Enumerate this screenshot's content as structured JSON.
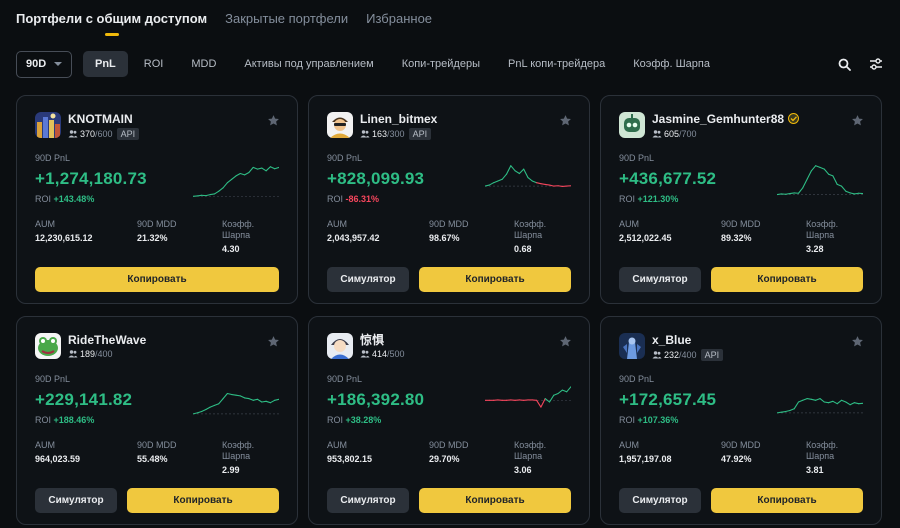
{
  "top_tabs": [
    {
      "label": "Портфели с общим доступом",
      "active": true
    },
    {
      "label": "Закрытые портфели",
      "active": false
    },
    {
      "label": "Избранное",
      "active": false
    }
  ],
  "filters": {
    "period": "90D",
    "sort_tabs": [
      {
        "label": "PnL",
        "active": true
      },
      {
        "label": "ROI",
        "active": false
      },
      {
        "label": "MDD",
        "active": false
      },
      {
        "label": "Активы под управлением",
        "active": false
      },
      {
        "label": "Копи-трейдеры",
        "active": false
      },
      {
        "label": "PnL копи-трейдера",
        "active": false
      },
      {
        "label": "Коэфф. Шарпа",
        "active": false
      }
    ],
    "icons": [
      "search-icon",
      "filter-settings-icon"
    ]
  },
  "card_labels": {
    "pnl": "90D PnL",
    "roi": "ROI",
    "aum": "AUM",
    "mdd": "90D MDD",
    "sharpe": "Коэфф. Шарпа",
    "simulator": "Симулятор",
    "copy": "Копировать",
    "api": "API"
  },
  "colors": {
    "positive": "#2ebd85",
    "negative": "#f6465d",
    "accent": "#f0b90b",
    "copy_button": "#f0c83e"
  },
  "cards": [
    {
      "name": "KNOTMAIN",
      "copiers": "370",
      "capacity": "/600",
      "api": true,
      "badge": false,
      "avatar": "city-night-avatar",
      "pnl": "+1,274,180.73",
      "roi": "+143.48%",
      "roi_sign": "pos",
      "aum": "12,230,615.12",
      "mdd": "21.32%",
      "sharpe": "4.30",
      "simulator": false,
      "spark": {
        "series": [
          0.05,
          0.06,
          0.08,
          0.07,
          0.1,
          0.12,
          0.2,
          0.3,
          0.45,
          0.55,
          0.65,
          0.72,
          0.68,
          0.75,
          0.9,
          0.85,
          0.88,
          0.8,
          0.92,
          0.86,
          0.9
        ],
        "color": "#2ebd85"
      }
    },
    {
      "name": "Linen_bitmex",
      "copiers": "163",
      "capacity": "/300",
      "api": true,
      "badge": false,
      "avatar": "cartoon-person-avatar",
      "pnl": "+828,099.93",
      "roi": "-86.31%",
      "roi_sign": "neg",
      "aum": "2,043,957.42",
      "mdd": "98.67%",
      "sharpe": "0.68",
      "simulator": true,
      "spark": {
        "series": [
          0.35,
          0.38,
          0.45,
          0.5,
          0.55,
          0.7,
          0.95,
          0.8,
          0.72,
          0.85,
          0.6,
          0.5,
          0.45,
          0.42,
          0.4,
          0.38,
          0.35,
          0.36,
          0.34,
          0.35,
          0.36
        ],
        "color": "#2ebd85",
        "tail_color": "#f6465d",
        "tail_from": 12
      }
    },
    {
      "name": "Jasmine_Gemhunter88",
      "copiers": "605",
      "capacity": "/700",
      "api": false,
      "badge": true,
      "avatar": "robot-avatar",
      "pnl": "+436,677.52",
      "roi": "+121.30%",
      "roi_sign": "pos",
      "aum": "2,512,022.45",
      "mdd": "89.32%",
      "sharpe": "3.28",
      "simulator": true,
      "spark": {
        "series": [
          0.1,
          0.12,
          0.11,
          0.13,
          0.15,
          0.14,
          0.3,
          0.55,
          0.8,
          0.95,
          0.9,
          0.85,
          0.7,
          0.65,
          0.4,
          0.35,
          0.2,
          0.15,
          0.12,
          0.14,
          0.13
        ],
        "color": "#2ebd85"
      }
    },
    {
      "name": "RideTheWave",
      "copiers": "189",
      "capacity": "/400",
      "api": false,
      "badge": false,
      "avatar": "frog-avatar",
      "pnl": "+229,141.82",
      "roi": "+188.46%",
      "roi_sign": "pos",
      "aum": "964,023.59",
      "mdd": "55.48%",
      "sharpe": "2.99",
      "simulator": true,
      "spark": {
        "series": [
          0.15,
          0.18,
          0.22,
          0.28,
          0.35,
          0.4,
          0.45,
          0.6,
          0.75,
          0.72,
          0.7,
          0.68,
          0.62,
          0.6,
          0.55,
          0.58,
          0.5,
          0.52,
          0.48,
          0.55,
          0.58
        ],
        "color": "#2ebd85"
      }
    },
    {
      "name": "惊惧",
      "copiers": "414",
      "capacity": "/500",
      "api": false,
      "badge": false,
      "avatar": "anime-person-avatar",
      "pnl": "+186,392.80",
      "roi": "+38.28%",
      "roi_sign": "pos",
      "aum": "953,802.15",
      "mdd": "29.70%",
      "sharpe": "3.06",
      "simulator": true,
      "spark": {
        "series": [
          0.55,
          0.55,
          0.55,
          0.56,
          0.55,
          0.55,
          0.56,
          0.55,
          0.56,
          0.55,
          0.56,
          0.56,
          0.55,
          0.35,
          0.6,
          0.5,
          0.7,
          0.75,
          0.85,
          0.8,
          0.95
        ],
        "color": "#2ebd85",
        "mid_color": "#f6465d",
        "mid_from": 0,
        "mid_to": 14
      }
    },
    {
      "name": "x_Blue",
      "copiers": "232",
      "capacity": "/400",
      "api": true,
      "badge": false,
      "avatar": "blue-armor-avatar",
      "pnl": "+172,657.45",
      "roi": "+107.36%",
      "roi_sign": "pos",
      "aum": "1,957,197.08",
      "mdd": "47.92%",
      "sharpe": "3.81",
      "simulator": true,
      "spark": {
        "series": [
          0.18,
          0.2,
          0.22,
          0.25,
          0.3,
          0.5,
          0.55,
          0.6,
          0.58,
          0.55,
          0.6,
          0.5,
          0.48,
          0.52,
          0.45,
          0.55,
          0.5,
          0.42,
          0.48,
          0.45,
          0.46
        ],
        "color": "#2ebd85"
      }
    }
  ]
}
